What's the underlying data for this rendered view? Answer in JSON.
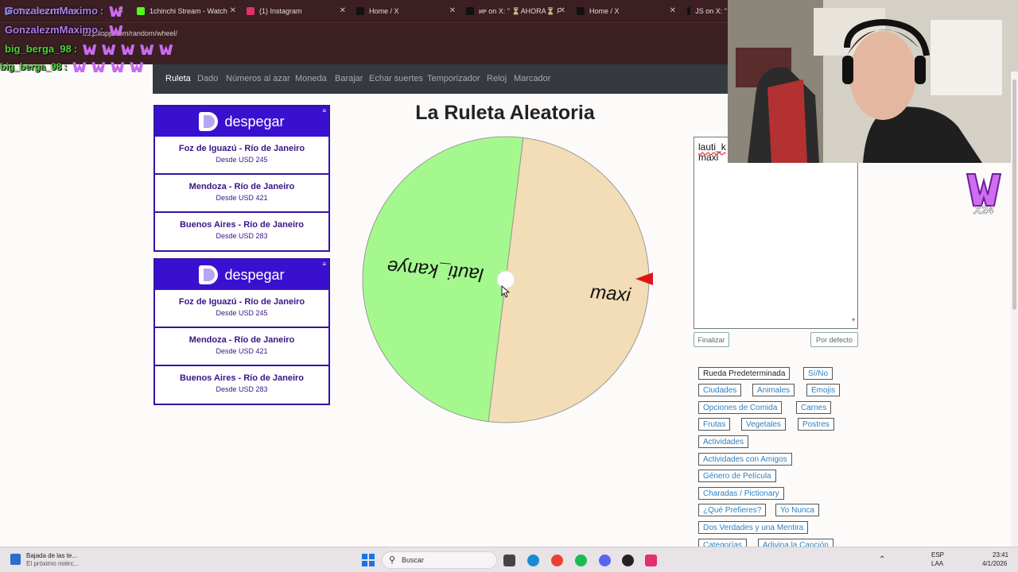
{
  "browser": {
    "tabs": [
      {
        "label": "GonzalezmMaximo:",
        "icon": "wheel-tab-icon"
      },
      {
        "label": "1chinchi Stream - Watch",
        "icon": "kick-icon"
      },
      {
        "label": "(1) Instagram",
        "icon": "instagram-icon"
      },
      {
        "label": "Home / X",
        "icon": "x-icon"
      },
      {
        "label": "ᴎᴘ on X: \" ⏳AHORA⏳ F",
        "icon": "x-icon"
      },
      {
        "label": "Home / X",
        "icon": "x-icon"
      },
      {
        "label": "JS on X: \"",
        "icon": "x-icon"
      }
    ],
    "url": "es.piliapp.com/random/wheel/"
  },
  "chat": [
    {
      "user": "GonzalezmMaximo",
      "sep": ":",
      "emotes": 1
    },
    {
      "user": "GonzalezmMaximo",
      "sep": ":",
      "emotes": 1
    },
    {
      "user": "big_berga_98",
      "sep": ":",
      "emotes": 5
    },
    {
      "user": "big_berga_98",
      "sep": ":",
      "emotes": 4
    }
  ],
  "nav": {
    "items": [
      "Ruleta",
      "Dado",
      "Números al azar",
      "Moneda",
      "Barajar",
      "Echar suertes",
      "Temporizador",
      "Reloj",
      "Marcador"
    ],
    "active": "Ruleta"
  },
  "ads": [
    {
      "brand": "despegar",
      "routes": [
        {
          "route": "Foz de Iguazú - Río de Janeiro",
          "price": "Desde USD 245"
        },
        {
          "route": "Mendoza - Río de Janeiro",
          "price": "Desde USD 421"
        },
        {
          "route": "Buenos Aires - Río de Janeiro",
          "price": "Desde USD 283"
        }
      ]
    },
    {
      "brand": "despegar",
      "routes": [
        {
          "route": "Foz de Iguazú - Río de Janeiro",
          "price": "Desde USD 245"
        },
        {
          "route": "Mendoza - Río de Janeiro",
          "price": "Desde USD 421"
        },
        {
          "route": "Buenos Aires - Río de Janeiro",
          "price": "Desde USD 283"
        }
      ]
    }
  ],
  "wheel": {
    "title": "La Ruleta Aleatoria",
    "segments": [
      {
        "label": "lauti_kanye",
        "color": "#a5f88d"
      },
      {
        "label": "maxi",
        "color": "#f2ddb6"
      }
    ],
    "pointer_color": "#e11414"
  },
  "names_textarea": {
    "lines": [
      "lauti_k",
      "maxi"
    ]
  },
  "controls": {
    "finish_label": "Finalizar",
    "default_label": "Por defecto"
  },
  "presets": [
    "Rueda Predeterminada",
    "Sí/No",
    "Ciudades",
    "Animales",
    "Emojis",
    "Opciones de Comida",
    "Carnes",
    "Frutas",
    "Vegetales",
    "Postres",
    "Actividades",
    "Actividades con Amigos",
    "Género de Película",
    "Charadas / Pictionary",
    "¿Qué Prefieres?",
    "Yo Nunca",
    "Dos Verdades y una Mentira",
    "Categorías",
    "Adivina la Canción"
  ],
  "overlay_logo": {
    "text": "X24"
  },
  "taskbar": {
    "notification_title": "Bajada de las te...",
    "notification_sub": "El próximo miérc...",
    "search_placeholder": "Buscar",
    "lang_top": "ESP",
    "lang_bottom": "LAA",
    "time": "23:41",
    "date": "4/1/2026"
  }
}
